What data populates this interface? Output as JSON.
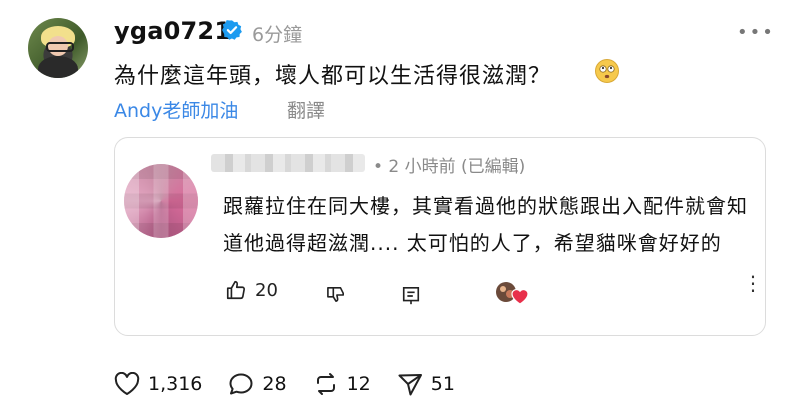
{
  "post": {
    "username": "yga0721",
    "time": "6分鐘",
    "text": "為什麼這年頭，壞人都可以生活得很滋潤？",
    "tag": "Andy老師加油",
    "translate_label": "翻譯"
  },
  "reply": {
    "time_text": "• 2 小時前 (已編輯)",
    "text": "跟蘿拉住在同大樓，其實看過他的狀態跟出入配件就會知道他過得超滋潤.... 太可怕的人了，希望貓咪會好好的",
    "likes": "20"
  },
  "stats": {
    "likes": "1,316",
    "comments": "28",
    "reposts": "12",
    "shares": "51"
  },
  "colors": {
    "accent_link": "#3b88e6",
    "verified": "#1d9bf0",
    "muted": "#8a8a8a"
  },
  "icons": [
    "verified-badge-icon",
    "more-icon",
    "like-icon",
    "dislike-icon",
    "comment-icon",
    "repost-icon",
    "share-icon",
    "heart-icon",
    "emoji-icon"
  ]
}
